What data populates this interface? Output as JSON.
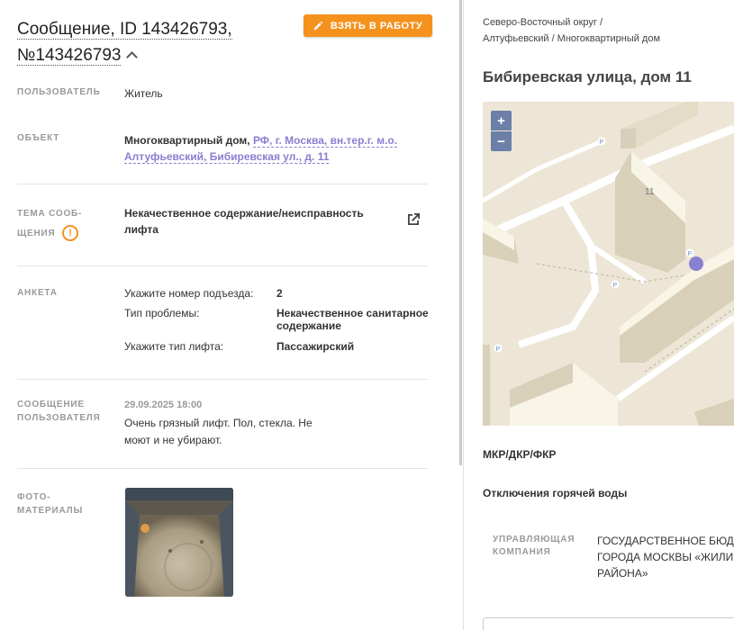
{
  "header": {
    "title_line1": "Сообщение, ID 143426793,",
    "title_line2": "№143426793",
    "take_button": "ВЗЯТЬ В РАБОТУ"
  },
  "details": {
    "user_label": "ПОЛЬЗОВАТЕЛЬ",
    "user_value": "Житель",
    "object_label": "ОБЪЕКТ",
    "object_type": "Многоквартирный дом,",
    "object_link_line1": "РФ, г. Москва, вн.тер.г. м.о.",
    "object_link_line2": "Алтуфьевский, Бибиревская ул., д. 11",
    "topic_label_line1": "ТЕМА СООБ-",
    "topic_label_line2": "ЩЕНИЯ",
    "topic_line1": "Некачественное содержание/неисправность",
    "topic_line2": "лифта",
    "survey_label": "АНКЕТА",
    "survey": [
      {
        "q": "Укажите номер подъезда:",
        "a": "2"
      },
      {
        "q": "Тип проблемы:",
        "a": "Некачественное санитарное содержание"
      },
      {
        "q": "Укажите тип лифта:",
        "a": "Пассажирский"
      }
    ],
    "message_label_line1": "СООБЩЕНИЕ",
    "message_label_line2": "ПОЛЬЗОВАТЕЛЯ",
    "message_date": "29.09.2025 18:00",
    "message_text": "Очень грязный лифт. Пол, стекла. Не моют и не убирают.",
    "photo_label_line1": "ФОТО-",
    "photo_label_line2": "МАТЕРИАЛЫ"
  },
  "right": {
    "breadcrumb_line1": "Северо-Восточный округ /",
    "breadcrumb_line2": "Алтуфьевский / Многоквартирный дом",
    "address": "Бибиревская улица, дом 11",
    "zoom_in": "+",
    "zoom_out": "−",
    "map_house_number": "11",
    "section1": "МКР/ДКР/ФКР",
    "section2": "Отключения горячей воды",
    "uk_label_line1": "УПРАВЛЯЮЩАЯ",
    "uk_label_line2": "КОМПАНИЯ",
    "uk_value_line1": "ГОСУДАРСТВЕННОЕ БЮДЖ",
    "uk_value_line2": "ГОРОДА МОСКВЫ «ЖИЛИ",
    "uk_value_line3": "РАЙОНА»"
  },
  "colors": {
    "accent": "#f5921e",
    "link": "#8a7fd0",
    "map_marker": "#8a7fd0"
  }
}
